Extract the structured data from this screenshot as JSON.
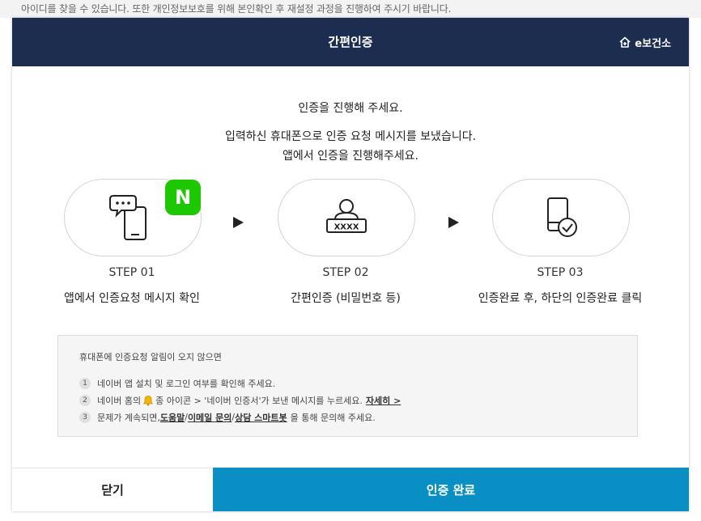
{
  "background": {
    "obscured_text": "아이디를 찾을 수 있습니다. 또한 개인정보보호를 위해 본인확인 후 재설정 과정을 진행하여 주시기 바랍니다."
  },
  "header": {
    "title": "간편인증",
    "brand": "e보건소",
    "brand_icon": "home-plus-icon",
    "bg_color": "#1c2d4f"
  },
  "intro": {
    "line1": "인증을 진행해 주세요.",
    "line2": "입력하신 휴대폰으로 인증 요청 메시지를 보냈습니다.",
    "line3": "앱에서 인증을 진행해주세요."
  },
  "steps": [
    {
      "label": "STEP 01",
      "desc": "앱에서 인증요청 메시지 확인",
      "icon": "phone-message-icon",
      "badge": "N"
    },
    {
      "label": "STEP 02",
      "desc": "간편인증 (비밀번호 등)",
      "icon": "user-password-icon",
      "password_mask": "XXXX"
    },
    {
      "label": "STEP 03",
      "desc": "인증완료 후, 하단의 인증완료 클릭",
      "icon": "phone-check-icon"
    }
  ],
  "notice": {
    "title": "휴대폰에 인증요청 알림이 오지 않으면",
    "items": [
      {
        "num": "1",
        "text": "네이버 앱 설치 및 로그인 여부를 확인해 주세요."
      },
      {
        "num": "2",
        "text_a": "네이버 홈의",
        "text_b": "종 아이콘 > '네이버 인증서'가 보낸 메시지를 누르세요.",
        "link": "자세히 >"
      },
      {
        "num": "3",
        "text_a": "문제가 계속되면,",
        "link1": "도움말",
        "sep1": "/",
        "link2": "이메일 문의",
        "sep2": "/",
        "link3": "상담 스마트봇",
        "text_b": "을 통해 문의해 주세요."
      }
    ]
  },
  "footer": {
    "close_label": "닫기",
    "done_label": "인증 완료",
    "done_color": "#0a8fc4"
  },
  "colors": {
    "naver_green": "#1ec800"
  }
}
